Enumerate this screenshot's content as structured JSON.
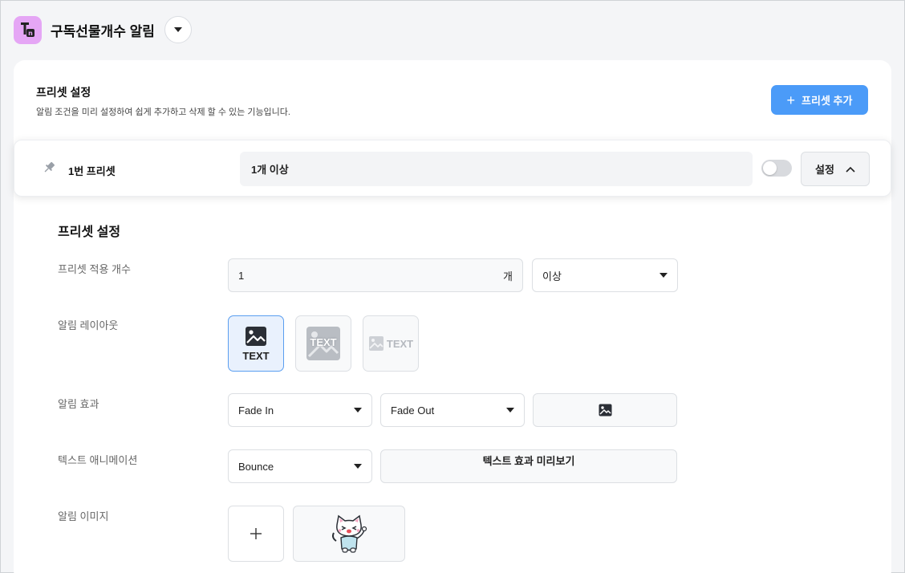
{
  "header": {
    "app_title": "구독선물개수 알림",
    "app_icon": "tn-logo-icon",
    "accent_color": "#e5a6f5"
  },
  "card": {
    "title": "프리셋 설정",
    "description": "알림 조건을 미리 설정하여 쉽게 추가하고 삭제 할 수 있는 기능입니다.",
    "add_button": {
      "icon": "plus-icon",
      "label": "프리셋 추가",
      "color": "#4b9bf8"
    }
  },
  "preset": {
    "name": "1번 프리셋",
    "summary": "1개 이상",
    "enabled": false,
    "settings_label": "설정"
  },
  "settings": {
    "section_title": "프리셋 설정",
    "apply_count": {
      "label": "프리셋 적용 개수",
      "value": "1",
      "unit": "개",
      "condition": "이상"
    },
    "layout": {
      "label": "알림 레이아웃",
      "options": [
        {
          "text": "TEXT",
          "selected": true
        },
        {
          "text": "TEXT",
          "selected": false
        },
        {
          "text": "TEXT",
          "selected": false
        }
      ]
    },
    "effect": {
      "label": "알림 효과",
      "in": "Fade In",
      "out": "Fade Out"
    },
    "text_animation": {
      "label": "텍스트 애니메이션",
      "value": "Bounce",
      "preview": "텍스트 효과 미리보기"
    },
    "image": {
      "label": "알림 이미지",
      "add_icon": "plus-icon",
      "thumbnail": "cat-character-image"
    }
  }
}
